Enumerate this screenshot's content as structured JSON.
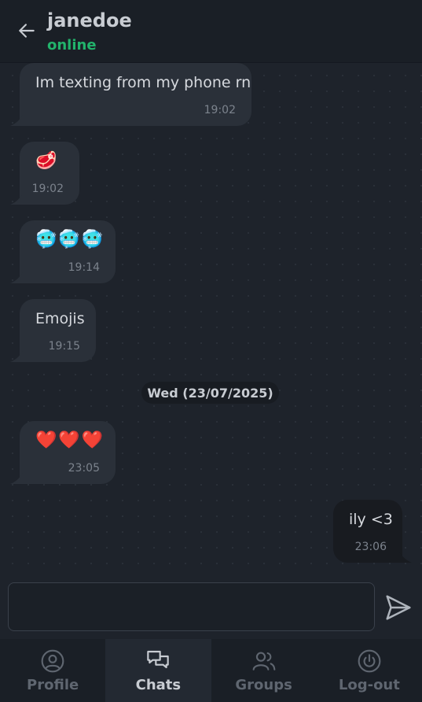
{
  "header": {
    "name": "janedoe",
    "status": "online"
  },
  "messages": [
    {
      "direction": "incoming",
      "text": "Im texting from my phone rn",
      "time": "19:02"
    },
    {
      "direction": "incoming",
      "text": "🥩",
      "time": "19:02"
    },
    {
      "direction": "incoming",
      "text": "🥶🥶🥶",
      "time": "19:14"
    },
    {
      "direction": "incoming",
      "text": "Emojis",
      "time": "19:15"
    },
    {
      "direction": "incoming",
      "text": "❤️❤️❤️",
      "time": "23:05"
    },
    {
      "direction": "outgoing",
      "text": "ily <3",
      "time": "23:06"
    }
  ],
  "date_divider": "Wed (23/07/2025)",
  "composer": {
    "value": "",
    "placeholder": ""
  },
  "nav": {
    "items": [
      {
        "label": "Profile",
        "icon": "profile-icon",
        "active": false
      },
      {
        "label": "Chats",
        "icon": "chats-icon",
        "active": true
      },
      {
        "label": "Groups",
        "icon": "groups-icon",
        "active": false
      },
      {
        "label": "Log-out",
        "icon": "power-icon",
        "active": false
      }
    ]
  },
  "colors": {
    "accent_online": "#22b36b",
    "background": "#1e232b",
    "incoming_bubble": "#2a3039",
    "outgoing_bubble": "#181b20"
  }
}
